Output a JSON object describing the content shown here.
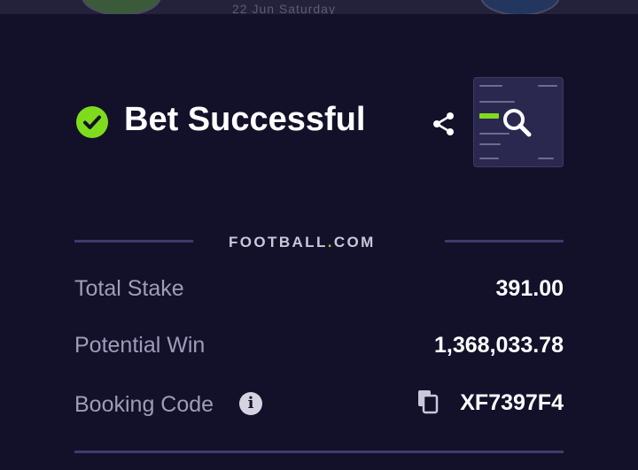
{
  "background_header": {
    "match_text": "22 Jun Saturday"
  },
  "status": {
    "title": "Bet Successful",
    "check_color": "#7fdc1d",
    "share_icon": "share-icon",
    "thumbnail_icon": "zoom-icon"
  },
  "brand": {
    "name_part1": "FOOTBALL",
    "dot": ".",
    "name_part2": "COM"
  },
  "rows": [
    {
      "label": "Total Stake",
      "value": "391.00"
    },
    {
      "label": "Potential Win",
      "value": "1,368,033.78"
    },
    {
      "label": "Booking Code",
      "value": "XF7397F4"
    }
  ],
  "info_icon_glyph": "i",
  "colors": {
    "accent": "#7fdc1d",
    "background": "#13112a",
    "label": "#9e9cb6"
  }
}
